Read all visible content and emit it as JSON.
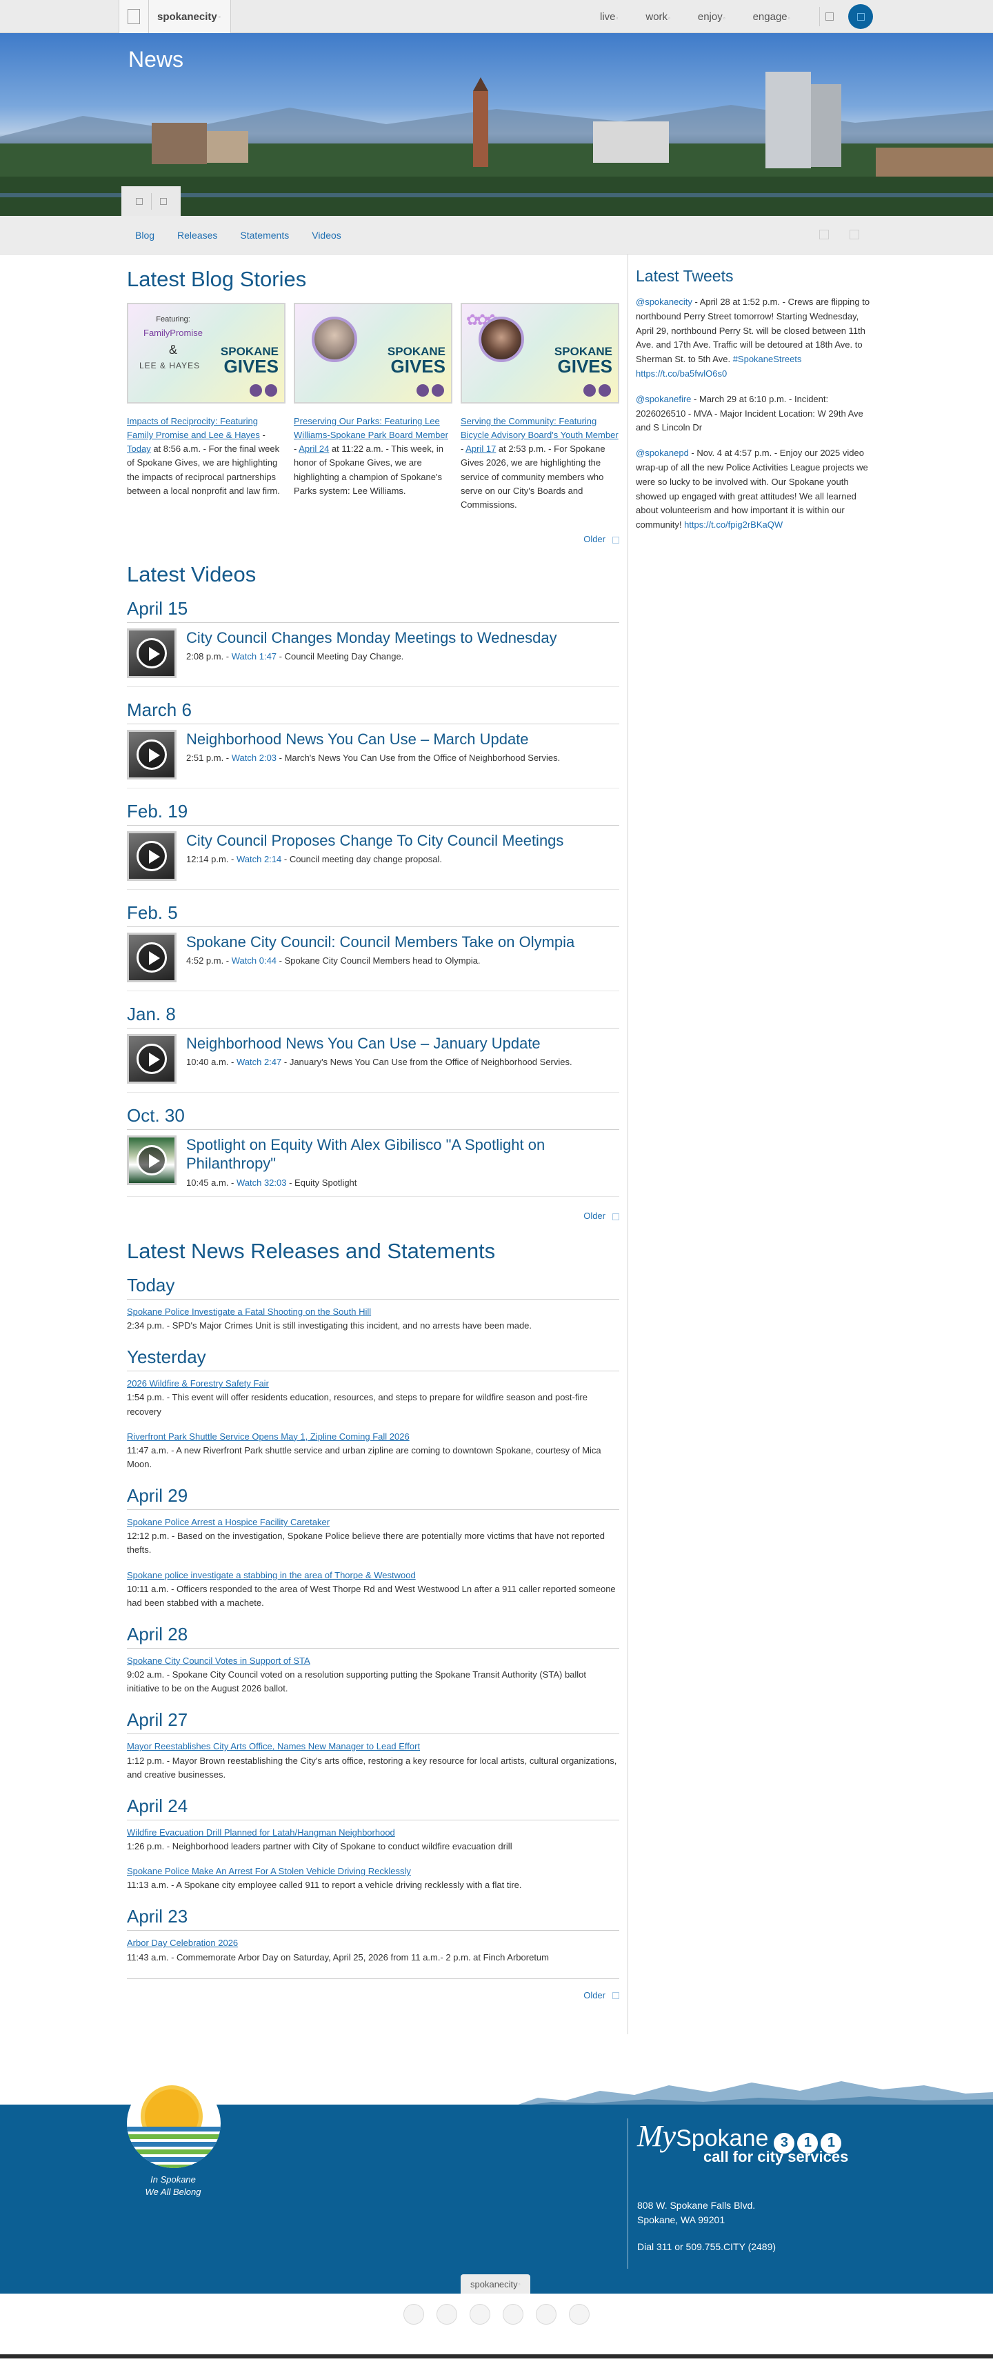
{
  "topnav": {
    "brand": "spokanecity",
    "menu": [
      "live",
      "work",
      "enjoy",
      "engage"
    ]
  },
  "hero": {
    "title": "News"
  },
  "subnav": {
    "links": [
      "Blog",
      "Releases",
      "Statements",
      "Videos"
    ]
  },
  "blog": {
    "heading": "Latest Blog Stories",
    "posts": [
      {
        "image": {
          "top": "Featuring:",
          "logo": "FamilyPromise",
          "amp": "&",
          "bottom": "LEE & HAYES",
          "brand1": "SPOKANE",
          "brand2": "GIVES"
        },
        "title": "Impacts of Reciprocity: Featuring Family Promise and Lee & Hayes",
        "sep": " - ",
        "date": "Today",
        "time": " at 8:56 a.m. - ",
        "summary": "For the final week of Spokane Gives, we are highlighting the impacts of reciprocal partnerships between a local nonprofit and law firm."
      },
      {
        "image": {
          "brand1": "SPOKANE",
          "brand2": "GIVES"
        },
        "title": "Preserving Our Parks: Featuring Lee Williams-Spokane Park Board Member",
        "sep": " - ",
        "date": "April 24",
        "time": " at 11:22 a.m. - ",
        "summary": "This week, in honor of Spokane Gives, we are highlighting a champion of Spokane's Parks system: Lee Williams."
      },
      {
        "image": {
          "brand1": "SPOKANE",
          "brand2": "GIVES"
        },
        "title": "Serving the Community: Featuring Bicycle Advisory Board's Youth Member",
        "sep": " - ",
        "date": "April 17",
        "time": " at 2:53 p.m. - ",
        "summary": "For Spokane Gives 2026, we are highlighting the service of community members who serve on our City's Boards and Commissions."
      }
    ],
    "older": "Older"
  },
  "videos": {
    "heading": "Latest Videos",
    "items": [
      {
        "date": "April 15",
        "title": "City Council Changes Monday Meetings to Wednesday",
        "time": "2:08 p.m. - ",
        "watch": "Watch 1:47",
        "desc": " - Council Meeting Day Change."
      },
      {
        "date": "March 6",
        "title": "Neighborhood News You Can Use – March Update",
        "time": "2:51 p.m. - ",
        "watch": "Watch 2:03",
        "desc": " - March's News You Can Use from the Office of Neighborhood Servies."
      },
      {
        "date": "Feb. 19",
        "title": "City Council Proposes Change To City Council Meetings",
        "time": "12:14 p.m. - ",
        "watch": "Watch 2:14",
        "desc": " - Council meeting day change proposal."
      },
      {
        "date": "Feb. 5",
        "title": "Spokane City Council: Council Members Take on Olympia",
        "time": "4:52 p.m. - ",
        "watch": "Watch 0:44",
        "desc": " - Spokane City Council Members head to Olympia."
      },
      {
        "date": "Jan. 8",
        "title": "Neighborhood News You Can Use – January Update",
        "time": "10:40 a.m. - ",
        "watch": "Watch 2:47",
        "desc": " - January's News You Can Use from the Office of Neighborhood Servies."
      },
      {
        "date": "Oct. 30",
        "title": "Spotlight on Equity With Alex Gibilisco \"A Spotlight on Philanthropy\"",
        "time": "10:45 a.m. - ",
        "watch": "Watch 32:03",
        "desc": " - Equity Spotlight"
      }
    ],
    "older": "Older"
  },
  "news": {
    "heading": "Latest News Releases and Statements",
    "groups": [
      {
        "date": "Today",
        "items": [
          {
            "title": "Spokane Police Investigate a Fatal Shooting on the South Hill",
            "text": "2:34 p.m. - SPD's Major Crimes Unit is still investigating this incident, and no arrests have been made."
          }
        ]
      },
      {
        "date": "Yesterday",
        "items": [
          {
            "title": "2026 Wildfire & Forestry Safety Fair",
            "text": "1:54 p.m. - This event will offer residents education, resources, and steps to prepare for wildfire season and post-fire recovery"
          },
          {
            "title": "Riverfront Park Shuttle Service Opens May 1, Zipline Coming Fall 2026",
            "text": "11:47 a.m. - A new Riverfront Park shuttle service and urban zipline are coming to downtown Spokane, courtesy of Mica Moon."
          }
        ]
      },
      {
        "date": "April 29",
        "items": [
          {
            "title": "Spokane Police Arrest a Hospice Facility Caretaker",
            "text": "12:12 p.m. - Based on the investigation, Spokane Police believe there are potentially more victims that have not reported thefts."
          },
          {
            "title": "Spokane police investigate a stabbing in the area of Thorpe & Westwood",
            "text": "10:11 a.m. - Officers responded to the area of West Thorpe Rd and West Westwood Ln after a 911 caller reported someone had been stabbed with a machete."
          }
        ]
      },
      {
        "date": "April 28",
        "items": [
          {
            "title": "Spokane City Council Votes in Support of STA",
            "text": "9:02 a.m. - Spokane City Council voted on a resolution supporting putting the Spokane Transit Authority (STA) ballot initiative to be on the August 2026 ballot."
          }
        ]
      },
      {
        "date": "April 27",
        "items": [
          {
            "title": "Mayor Reestablishes City Arts Office, Names New Manager to Lead Effort",
            "text": "1:12 p.m. - Mayor Brown reestablishing the City's arts office, restoring a key resource for local artists, cultural organizations, and creative businesses."
          }
        ]
      },
      {
        "date": "April 24",
        "items": [
          {
            "title": "Wildfire Evacuation Drill Planned for Latah/Hangman Neighborhood",
            "text": "1:26 p.m. - Neighborhood leaders partner with City of Spokane to conduct wildfire evacuation drill"
          },
          {
            "title": "Spokane Police Make An Arrest For A Stolen Vehicle Driving Recklessly",
            "text": "11:13 a.m. - A Spokane city employee called 911 to report a vehicle driving recklessly with a flat tire."
          }
        ]
      },
      {
        "date": "April 23",
        "items": [
          {
            "title": "Arbor Day Celebration 2026",
            "text": "11:43 a.m. - Commemorate Arbor Day on Saturday, April 25, 2026 from 11 a.m.- 2 p.m. at Finch Arboretum"
          }
        ]
      }
    ],
    "older": "Older"
  },
  "tweets": {
    "heading": "Latest Tweets",
    "items": [
      {
        "handle": "@spokanecity",
        "text": " - April 28 at 1:52 p.m. - Crews are flipping to northbound Perry Street tomorrow! Starting Wednesday, April 29, northbound Perry St. will be closed between 11th Ave. and 17th Ave. Traffic will be detoured at 18th Ave. to Sherman St. to 5th Ave. ",
        "tag": "#SpokaneStreets",
        "link": " https://t.co/ba5fwlO6s0"
      },
      {
        "handle": "@spokanefire",
        "text": " - March 29 at 6:10 p.m. - Incident: 2026026510 - MVA - Major Incident Location: W 29th Ave and S Lincoln Dr",
        "tag": "",
        "link": ""
      },
      {
        "handle": "@spokanepd",
        "text": " - Nov. 4 at 4:57 p.m. - Enjoy our 2025 video wrap-up of all the new Police Activities League projects we were so lucky to be involved with. Our Spokane youth showed up engaged with great attitudes! We all learned about volunteerism and how important it is within our community! ",
        "tag": "",
        "link": "https://t.co/fpig2rBKaQW"
      }
    ]
  },
  "footer": {
    "tagline1": "In Spokane",
    "tagline2": "We All Belong",
    "my": "My",
    "spokane": "Spokane",
    "digits": [
      "3",
      "1",
      "1"
    ],
    "call": "call for city services",
    "addr1": "808 W. Spokane Falls Blvd.",
    "addr2": "Spokane, WA 99201",
    "phone": "Dial 311 or 509.755.CITY (2489)",
    "tab": "spokanecity"
  },
  "colors": {
    "accent": "#155a8c",
    "link": "#1f6fb2",
    "footer": "#0c5f94"
  }
}
